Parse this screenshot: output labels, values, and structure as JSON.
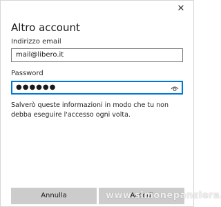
{
  "dialog": {
    "close_glyph": "✕",
    "title": "Altro account",
    "email_label": "Indirizzo email",
    "email_value": "mail@libero.it",
    "password_label": "Password",
    "password_value": "●●●●●●",
    "info_text": "Salverò queste informazioni in modo che tu non debba eseguire l'accesso ogni volta.",
    "cancel_label": "Annulla",
    "signin_label": "Accedi"
  },
  "watermark": "www.simonepanziera.it",
  "colors": {
    "accent": "#0078d7",
    "button_bg": "#cccccc",
    "border": "#7a7a7a"
  }
}
